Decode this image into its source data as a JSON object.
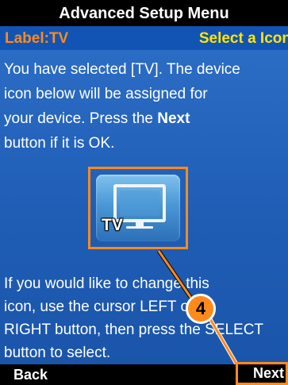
{
  "header": {
    "title": "Advanced Setup Menu"
  },
  "subheader": {
    "label": "Label:TV",
    "action": "Select a Icon"
  },
  "message": {
    "line1": "You have selected [TV]. The device",
    "line2": "icon below will be assigned for",
    "line3_pre": "your device. Press the ",
    "line3_bold": "Next",
    "line4": "button if it is OK."
  },
  "selected_icon": {
    "name": "tv-icon",
    "label": "TV"
  },
  "instructions": {
    "line1": "If you would like to change this",
    "line2": "icon, use the cursor LEFT or",
    "line3": "RIGHT button, then press the SELECT",
    "line4": "button to select."
  },
  "callout": {
    "number": "4"
  },
  "softkeys": {
    "left": "Back",
    "right": "Next"
  },
  "colors": {
    "accent_orange": "#ff8a1c",
    "header_blue": "#1254b4",
    "screen_blue": "#2b6cc4",
    "select_yellow": "#ffe600"
  }
}
